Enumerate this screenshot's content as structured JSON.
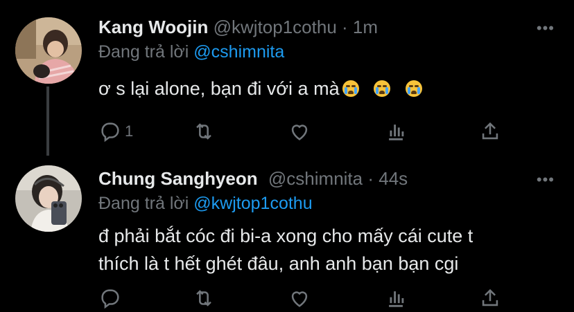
{
  "tweets": [
    {
      "name": "Kang Woojin",
      "handle": "@kwjtop1cothu",
      "separator": "·",
      "time": "1m",
      "reply_prefix": "Đang trả lời",
      "reply_to": "@cshimnita",
      "text": "ơ s lại alone, bạn đi với a mà",
      "emoji": [
        "loudly-crying-face",
        "loudly-crying-face",
        "loudly-crying-face"
      ],
      "reply_count": "1"
    },
    {
      "name": "Chung Sanghyeon",
      "handle": "@cshimnita",
      "separator": "·",
      "time": "44s",
      "reply_prefix": "Đang trả lời",
      "reply_to": "@kwjtop1cothu",
      "text_line1": "đ phải bắt cóc đi bi-a xong cho mấy cái cute t",
      "text_line2": "thích là t hết ghét đâu, anh anh bạn bạn cgi",
      "reply_count": ""
    }
  ],
  "more_label": "•••",
  "colors": {
    "background": "#000000",
    "text": "#e7e9ea",
    "secondary": "#71767b",
    "accent": "#1d9bf0"
  }
}
